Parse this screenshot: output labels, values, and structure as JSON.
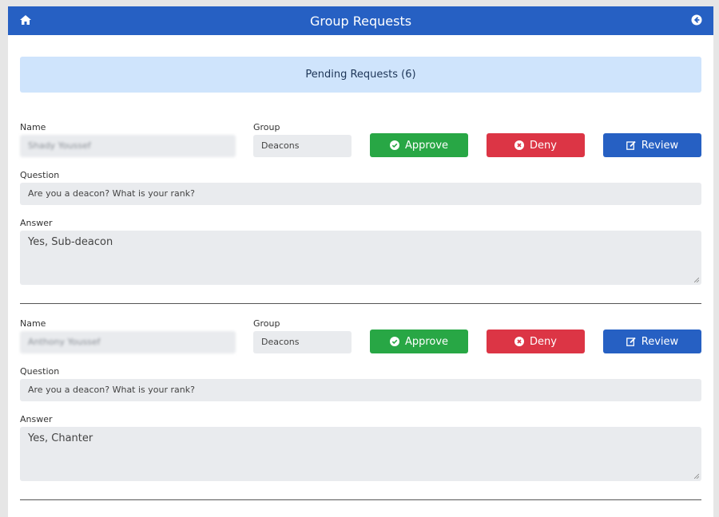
{
  "header": {
    "title": "Group Requests",
    "home_icon": "home-icon",
    "back_icon": "arrow-circle-left-icon",
    "color": "#2660c3"
  },
  "banner": {
    "text": "Pending Requests (6)",
    "color": "#cfe4fc"
  },
  "labels": {
    "name": "Name",
    "group": "Group",
    "question": "Question",
    "answer": "Answer"
  },
  "buttons": {
    "approve": "Approve",
    "deny": "Deny",
    "review": "Review",
    "approve_color": "#28a745",
    "deny_color": "#dc3545",
    "review_color": "#2660c3"
  },
  "requests": [
    {
      "name": "Shady Youssef",
      "group": "Deacons",
      "question": "Are you a deacon? What is your rank?",
      "answer": "Yes, Sub-deacon"
    },
    {
      "name": "Anthony Youssef",
      "group": "Deacons",
      "question": "Are you a deacon? What is your rank?",
      "answer": "Yes, Chanter"
    }
  ]
}
